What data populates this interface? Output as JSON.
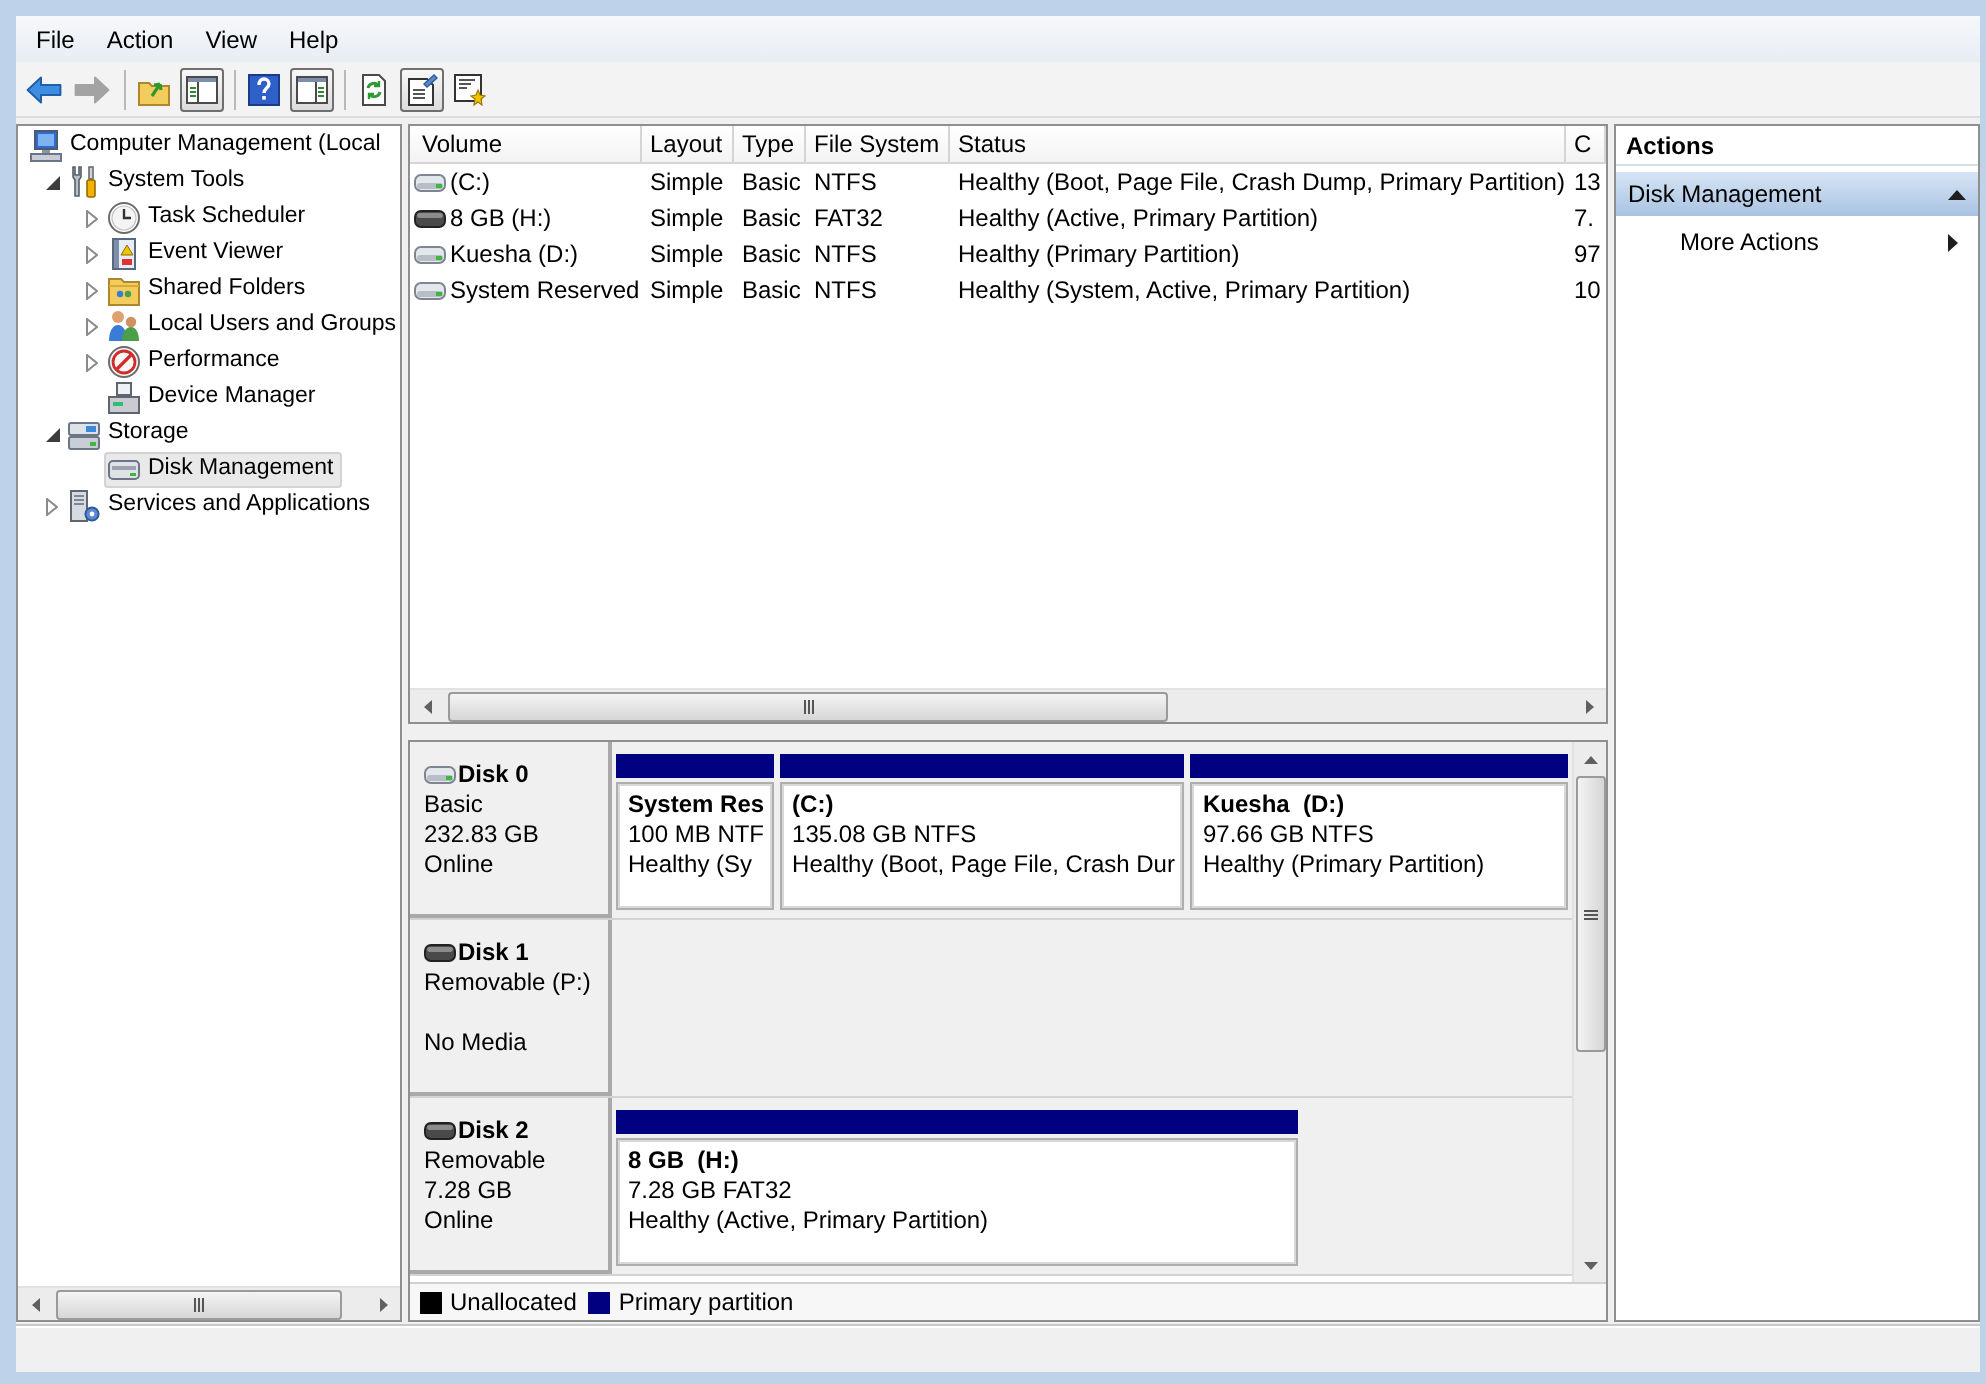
{
  "menu": [
    "File",
    "Action",
    "View",
    "Help"
  ],
  "toolbar": {
    "groups": [
      [
        {
          "kind": "back",
          "pressed": false,
          "disabled": false
        },
        {
          "kind": "forward",
          "pressed": false,
          "disabled": true
        }
      ],
      [
        {
          "kind": "up",
          "pressed": false,
          "disabled": false
        },
        {
          "kind": "console_tree",
          "pressed": true,
          "disabled": false
        }
      ],
      [
        {
          "kind": "help",
          "pressed": false,
          "disabled": false
        },
        {
          "kind": "action_pane",
          "pressed": true,
          "disabled": false
        }
      ],
      [
        {
          "kind": "refresh",
          "pressed": false,
          "disabled": false
        },
        {
          "kind": "properties",
          "pressed": true,
          "disabled": false
        },
        {
          "kind": "wizard",
          "pressed": false,
          "disabled": false
        }
      ]
    ]
  },
  "tree": [
    {
      "label": "Computer Management (Local",
      "kind": "computer",
      "expandable": false,
      "selected": false,
      "children": [
        {
          "label": "System Tools",
          "kind": "tools",
          "expandable": true,
          "expanded": true,
          "selected": false,
          "children": [
            {
              "label": "Task Scheduler",
              "kind": "clock",
              "expandable": true,
              "expanded": false,
              "selected": false
            },
            {
              "label": "Event Viewer",
              "kind": "event",
              "expandable": true,
              "expanded": false,
              "selected": false
            },
            {
              "label": "Shared Folders",
              "kind": "folder",
              "expandable": true,
              "expanded": false,
              "selected": false
            },
            {
              "label": "Local Users and Groups",
              "kind": "users",
              "expandable": true,
              "expanded": false,
              "selected": false
            },
            {
              "label": "Performance",
              "kind": "gauge",
              "expandable": true,
              "expanded": false,
              "selected": false
            },
            {
              "label": "Device Manager",
              "kind": "device",
              "expandable": false,
              "selected": false
            }
          ]
        },
        {
          "label": "Storage",
          "kind": "storage",
          "expandable": true,
          "expanded": true,
          "selected": false,
          "children": [
            {
              "label": "Disk Management",
              "kind": "disk",
              "expandable": false,
              "selected": true
            }
          ]
        },
        {
          "label": "Services and Applications",
          "kind": "services",
          "expandable": true,
          "expanded": false,
          "selected": false
        }
      ]
    }
  ],
  "volumes": {
    "columns": [
      "Volume",
      "Layout",
      "Type",
      "File System",
      "Status",
      "C"
    ],
    "rows": [
      {
        "kind": "fixed",
        "selected": false,
        "cells": [
          "(C:)",
          "Simple",
          "Basic",
          "NTFS",
          "Healthy (Boot, Page File, Crash Dump, Primary Partition)",
          "13"
        ]
      },
      {
        "kind": "removable",
        "selected": false,
        "cells": [
          "8 GB (H:)",
          "Simple",
          "Basic",
          "FAT32",
          "Healthy (Active, Primary Partition)",
          "7."
        ]
      },
      {
        "kind": "fixed",
        "selected": false,
        "cells": [
          "Kuesha (D:)",
          "Simple",
          "Basic",
          "NTFS",
          "Healthy (Primary Partition)",
          "97"
        ]
      },
      {
        "kind": "fixed",
        "selected": false,
        "cells": [
          "System Reserved",
          "Simple",
          "Basic",
          "NTFS",
          "Healthy (System, Active, Primary Partition)",
          "10"
        ]
      }
    ]
  },
  "disks": [
    {
      "name": "Disk 0",
      "kind": "fixed",
      "type": "Basic",
      "size": "232.83 GB",
      "status": "Online",
      "partitions": [
        {
          "name": "System Res",
          "detail": "100 MB NTF",
          "status": "Healthy (Sy",
          "level": 0.16,
          "color": "#000080"
        },
        {
          "name": "(C:)",
          "detail": "135.08 GB NTFS",
          "status": "Healthy (Boot, Page File, Crash Dur",
          "level": 0.42,
          "color": "#000080"
        },
        {
          "name": "Kuesha  (D:)",
          "detail": "97.66 GB NTFS",
          "status": "Healthy (Primary Partition)",
          "level": 0.42,
          "color": "#000080"
        }
      ]
    },
    {
      "name": "Disk 1",
      "kind": "removable",
      "type": "Removable (P:)",
      "status": "No Media"
    },
    {
      "name": "Disk 2",
      "kind": "removable",
      "type": "Removable",
      "size": "7.28 GB",
      "status": "Online",
      "partitions": [
        {
          "name": "8 GB  (H:)",
          "detail": "7.28 GB FAT32",
          "status": "Healthy (Active, Primary Partition)",
          "level": 0.72,
          "color": "#000080"
        }
      ]
    }
  ],
  "legend": [
    {
      "label": "Unallocated",
      "color": "#000000"
    },
    {
      "label": "Primary partition",
      "color": "#000080"
    }
  ],
  "actions": {
    "title": "Actions",
    "sections": [
      {
        "label": "Disk Management",
        "expanded": true,
        "items": [
          {
            "label": "More Actions",
            "submenu": true
          }
        ]
      }
    ]
  }
}
